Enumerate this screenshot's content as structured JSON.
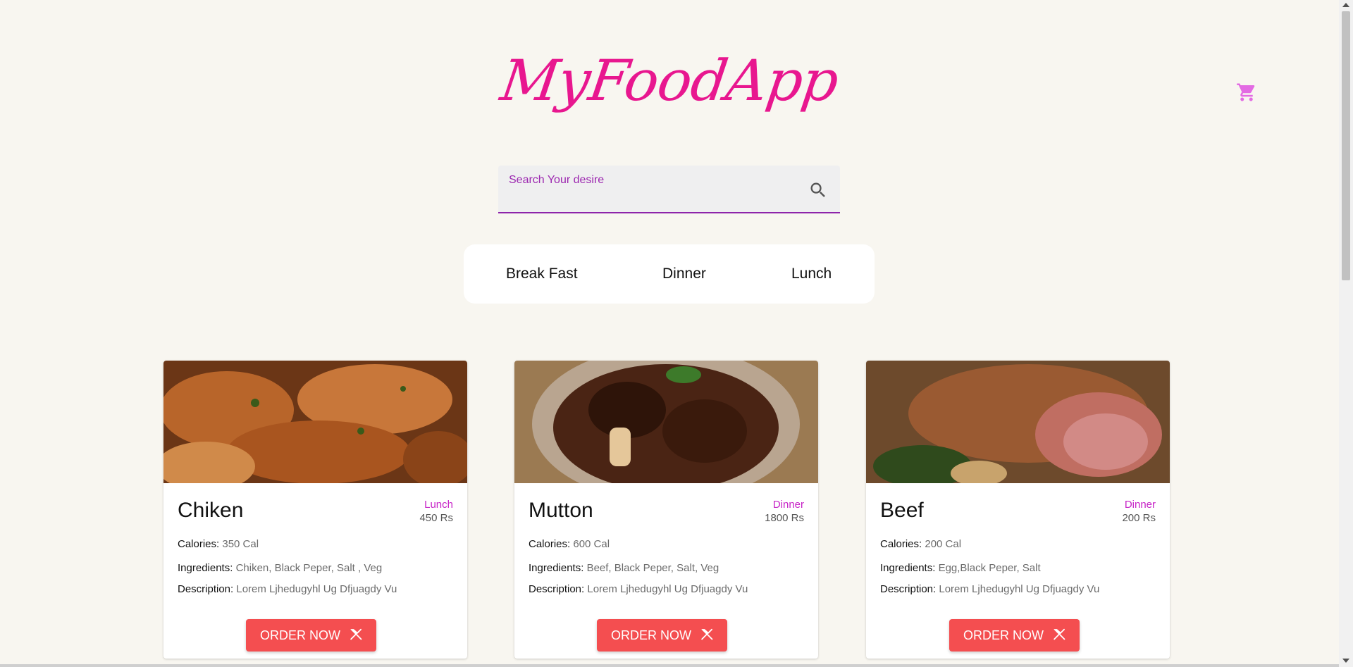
{
  "app": {
    "logo_text": "MyFoodApp",
    "brand_color": "#e8178f",
    "cart_icon": "shopping-cart-icon"
  },
  "search": {
    "label": "Search Your desire",
    "value": "",
    "icon": "search-icon"
  },
  "tabs": [
    {
      "label": "Break Fast"
    },
    {
      "label": "Dinner"
    },
    {
      "label": "Lunch"
    }
  ],
  "labels": {
    "calories": "Calories:",
    "ingredients": "Ingredients:",
    "description": "Description:",
    "order_button": "ORDER NOW",
    "order_icon": "cutlery-icon"
  },
  "cards": [
    {
      "name": "Chiken",
      "category": "Lunch",
      "price": "450 Rs",
      "calories": "350 Cal",
      "ingredients": "Chiken, Black Peper, Salt , Veg",
      "description": "Lorem Ljhedugyhl Ug Dfjuagdy Vu"
    },
    {
      "name": "Mutton",
      "category": "Dinner",
      "price": "1800 Rs",
      "calories": "600 Cal",
      "ingredients": "Beef, Black Peper, Salt, Veg",
      "description": "Lorem Ljhedugyhl Ug Dfjuagdy Vu"
    },
    {
      "name": "Beef",
      "category": "Dinner",
      "price": "200 Rs",
      "calories": "200 Cal",
      "ingredients": "Egg,Black Peper, Salt",
      "description": "Lorem Ljhedugyhl Ug Dfjuagdy Vu"
    }
  ],
  "colors": {
    "accent": "#9c27b0",
    "button": "#f44e50",
    "category": "#c724c7",
    "background": "#f8f6f0"
  }
}
